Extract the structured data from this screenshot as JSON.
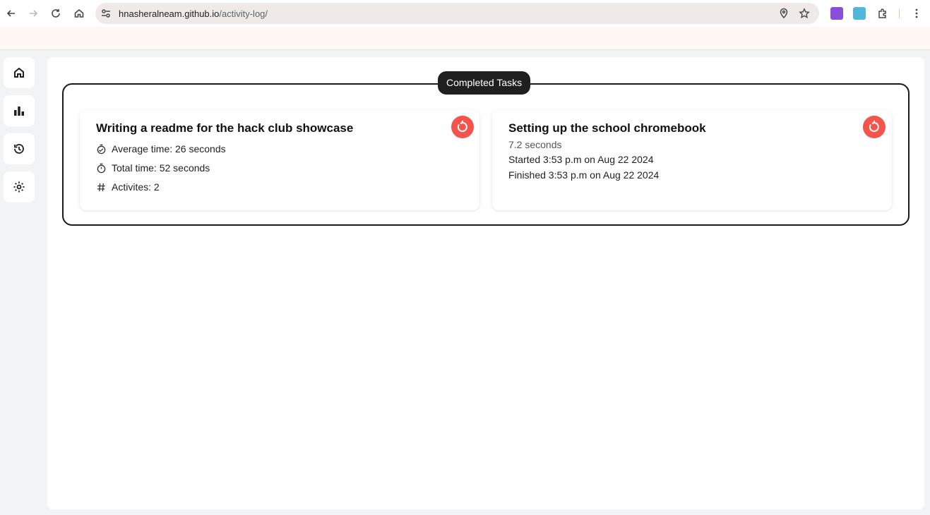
{
  "browser": {
    "url_host": "hnasheralneam.github.io",
    "url_path": "/activity-log/"
  },
  "sidebar": {
    "items": [
      {
        "icon": "home-icon"
      },
      {
        "icon": "bar-chart-icon"
      },
      {
        "icon": "history-icon"
      },
      {
        "icon": "gear-icon"
      }
    ]
  },
  "section": {
    "label": "Completed Tasks"
  },
  "tasks": [
    {
      "title": "Writing a readme for the hack club showcase",
      "average": "Average time: 26 seconds",
      "total": "Total time: 52 seconds",
      "activities": "Activites: 2"
    },
    {
      "title": "Setting up the school chromebook",
      "duration": "7.2 seconds",
      "started": "Started 3:53 p.m on Aug 22 2024",
      "finished": "Finished 3:53 p.m on Aug 22 2024"
    }
  ],
  "colors": {
    "reset_button": "#f4544c",
    "label_bg": "#1f1f1f"
  }
}
